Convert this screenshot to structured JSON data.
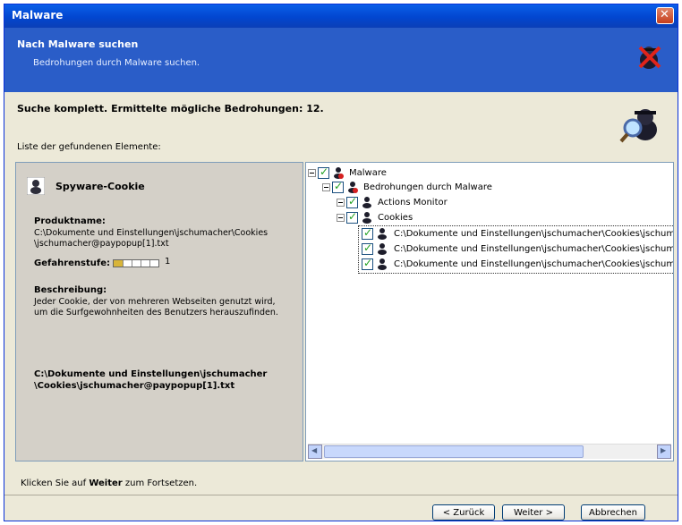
{
  "window": {
    "title": "Malware"
  },
  "header": {
    "title": "Nach Malware suchen",
    "subtitle": "Bedrohungen durch Malware suchen."
  },
  "result": {
    "text": "Suche komplett. Ermittelte mögliche Bedrohungen: 12."
  },
  "list_label": "Liste der gefundenen Elemente:",
  "details": {
    "title": "Spyware-Cookie",
    "product_label": "Produktname:",
    "product_value_line1": "C:\\Dokumente und Einstellungen\\jschumacher\\Cookies",
    "product_value_line2": "\\jschumacher@paypopup[1].txt",
    "danger_label": "Gefahrenstufe:",
    "danger_level": "1",
    "danger_fraction": 0.2,
    "desc_label": "Beschreibung:",
    "desc_line1": "Jeder Cookie, der von mehreren Webseiten genutzt wird,",
    "desc_line2": "um die Surfgewohnheiten des Benutzers herauszufinden.",
    "path_line1": "C:\\Dokumente und Einstellungen\\jschumacher",
    "path_line2": "\\Cookies\\jschumacher@paypopup[1].txt"
  },
  "tree": {
    "root": "Malware",
    "group": "Bedrohungen durch Malware",
    "actions_monitor": "Actions Monitor",
    "cookies": "Cookies",
    "cookie_items": [
      "C:\\Dokumente und Einstellungen\\jschumacher\\Cookies\\jschuma",
      "C:\\Dokumente und Einstellungen\\jschumacher\\Cookies\\jschuma",
      "C:\\Dokumente und Einstellungen\\jschumacher\\Cookies\\jschuma"
    ]
  },
  "footer": {
    "text_prefix": "Klicken Sie auf ",
    "text_bold": "Weiter",
    "text_suffix": " zum Fortsetzen."
  },
  "buttons": {
    "back": "< Zurück",
    "next": "Weiter >",
    "cancel": "Abbrechen"
  },
  "colors": {
    "titlebar": "#0A5FE8",
    "header": "#2A5DC8",
    "panel": "#D4D0C8",
    "check": "#21A121"
  }
}
